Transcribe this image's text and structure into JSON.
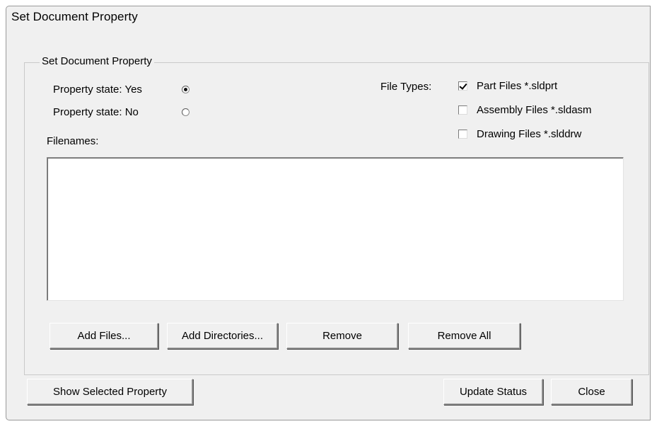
{
  "window": {
    "title": "Set Document Property"
  },
  "group": {
    "label": "Set Document Property"
  },
  "property_state": {
    "yes_label": "Property state: Yes",
    "no_label": "Property state: No",
    "selected": "yes"
  },
  "file_types": {
    "label": "File Types:",
    "options": [
      {
        "label": "Part Files *.sldprt",
        "checked": true
      },
      {
        "label": "Assembly Files *.sldasm",
        "checked": false
      },
      {
        "label": "Drawing Files *.slddrw",
        "checked": false
      }
    ]
  },
  "filenames": {
    "label": "Filenames:",
    "items": []
  },
  "buttons": {
    "add_files": "Add Files...",
    "add_directories": "Add Directories...",
    "remove": "Remove",
    "remove_all": "Remove All",
    "show_selected_property": "Show Selected Property",
    "update_status": "Update Status",
    "close": "Close"
  }
}
